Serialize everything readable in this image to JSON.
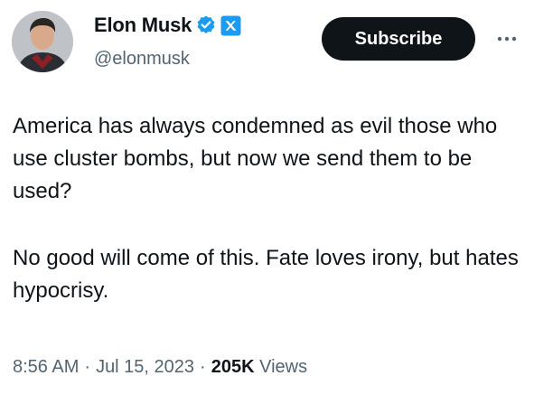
{
  "author": {
    "display_name": "Elon Musk",
    "handle": "@elonmusk",
    "verified_badge_icon": "verified-check-badge",
    "affiliate_badge_icon": "x-affiliate-square"
  },
  "header": {
    "subscribe_label": "Subscribe",
    "more_icon": "ellipsis-horizontal"
  },
  "tweet": {
    "paragraphs": [
      "America has always condemned as evil those who use cluster bombs, but now we send them to be used?",
      "No good will come of this. Fate loves irony, but hates hypocrisy."
    ]
  },
  "meta": {
    "time": "8:56 AM",
    "date": "Jul 15, 2023",
    "views_count": "205K",
    "views_label": "Views"
  },
  "colors": {
    "text_primary": "#0f1419",
    "text_secondary": "#536471",
    "verified_blue": "#1d9bf0",
    "button_dark": "#0f1419"
  }
}
